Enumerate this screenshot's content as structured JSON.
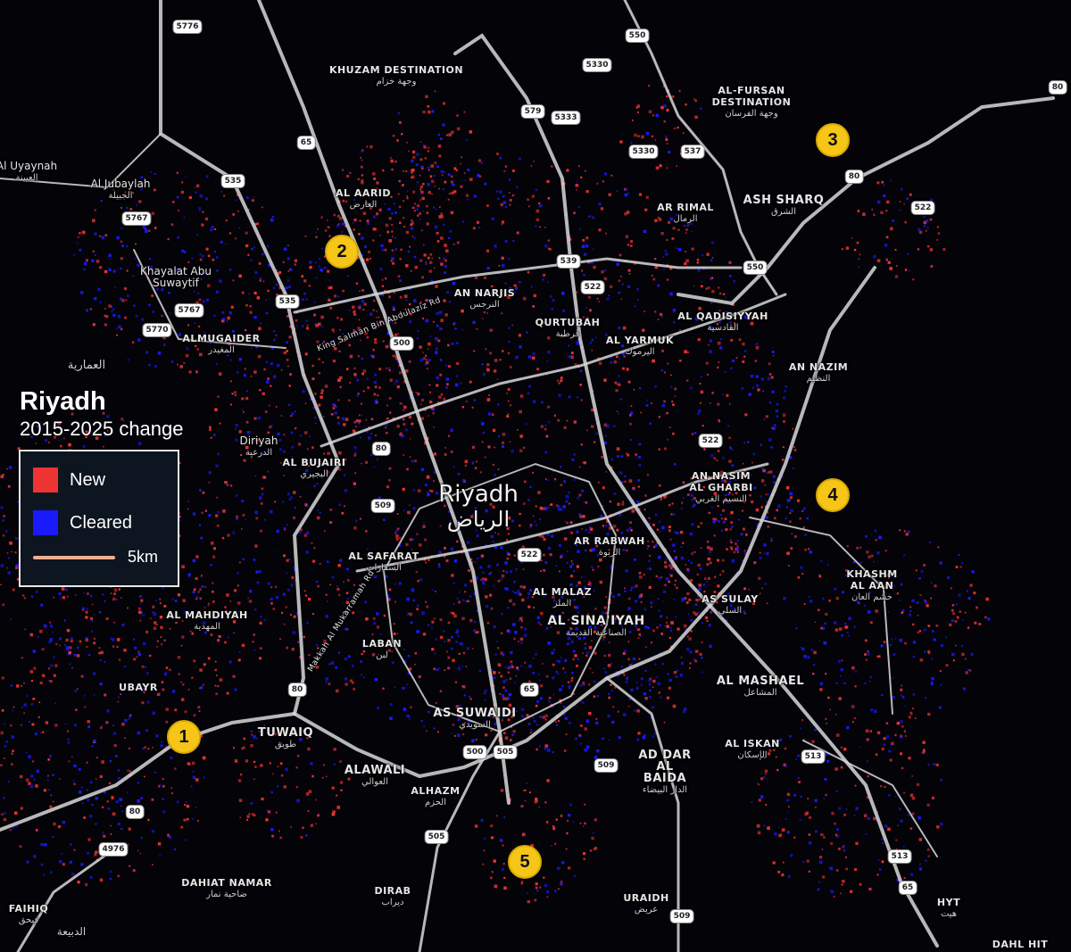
{
  "title": {
    "city": "Riyadh",
    "period": "2015-2025 change"
  },
  "legend": {
    "items": [
      {
        "label": "New",
        "color": "#ee3333"
      },
      {
        "label": "Cleared",
        "color": "#1a1aff"
      }
    ],
    "scale": {
      "label": "5km",
      "color": "#f0b090"
    }
  },
  "city_label": {
    "en": "Riyadh",
    "ar": "الرياض"
  },
  "places": [
    {
      "id": "khuzam",
      "en": "KHUZAM DESTINATION",
      "ar": "وجهة خزام"
    },
    {
      "id": "al-fursan",
      "en": "AL-FURSAN DESTINATION",
      "ar": "وجهة الفرسان"
    },
    {
      "id": "al-uyaynah",
      "en": "Al Uyaynah",
      "ar": "العيينة"
    },
    {
      "id": "al-jubaylah",
      "en": "Al Jubaylah",
      "ar": "الجبيلة"
    },
    {
      "id": "al-aarid",
      "en": "AL AARID",
      "ar": "العارض"
    },
    {
      "id": "ar-rimal",
      "en": "AR RIMAL",
      "ar": "الرمال"
    },
    {
      "id": "ash-sharq",
      "en": "ASH SHARQ",
      "ar": "الشرق"
    },
    {
      "id": "khayalat",
      "en": "Khayalat Abu Suwaytif",
      "ar": ""
    },
    {
      "id": "an-narjis",
      "en": "AN NARJIS",
      "ar": "النرجس"
    },
    {
      "id": "qurtubah",
      "en": "QURTUBAH",
      "ar": "قرطبة"
    },
    {
      "id": "al-qadisiyyah",
      "en": "AL QADISIYYAH",
      "ar": "القادسية"
    },
    {
      "id": "al-yarmuk",
      "en": "AL YARMUK",
      "ar": "اليرموك"
    },
    {
      "id": "almugaider",
      "en": "ALMUGAIDER",
      "ar": "المغيدر"
    },
    {
      "id": "al-amariyah",
      "en": "",
      "ar": "العمارية"
    },
    {
      "id": "an-nazim",
      "en": "AN NAZIM",
      "ar": "النظيم"
    },
    {
      "id": "diriyah",
      "en": "Diriyah",
      "ar": "الدرعية"
    },
    {
      "id": "al-bujairi",
      "en": "AL BUJAIRI",
      "ar": "البجيري"
    },
    {
      "id": "an-nasim-gharbi",
      "en": "AN NASIM AL GHARBI",
      "ar": "النسيم الغربي"
    },
    {
      "id": "ar-rabwah",
      "en": "AR RABWAH",
      "ar": "الربوة"
    },
    {
      "id": "al-safarat",
      "en": "AL SAFARAT",
      "ar": "السفارات"
    },
    {
      "id": "khashm-al-aan",
      "en": "KHASHM AL AAN",
      "ar": "خشم العان"
    },
    {
      "id": "al-malaz",
      "en": "AL MALAZ",
      "ar": "الملز"
    },
    {
      "id": "as-sulay",
      "en": "AS SULAY",
      "ar": "السلي"
    },
    {
      "id": "al-mahdiyah",
      "en": "AL MAHDIYAH",
      "ar": "المهدية"
    },
    {
      "id": "al-sinaiyah",
      "en": "AL SINA'IYAH",
      "ar": "الصناعية القديمة"
    },
    {
      "id": "laban",
      "en": "LABAN",
      "ar": "لبن"
    },
    {
      "id": "ubayr",
      "en": "UBAYR",
      "ar": ""
    },
    {
      "id": "al-mashael",
      "en": "AL MASHAEL",
      "ar": "المشاعل"
    },
    {
      "id": "as-suwaidi",
      "en": "AS SUWAIDI",
      "ar": "السويدي"
    },
    {
      "id": "tuwaiq",
      "en": "TUWAIQ",
      "ar": "طويق"
    },
    {
      "id": "al-iskan",
      "en": "AL ISKAN",
      "ar": "الإسكان"
    },
    {
      "id": "ad-dar-al-baida",
      "en": "AD DAR AL BAIDA",
      "ar": "الدار البيضاء"
    },
    {
      "id": "alawali",
      "en": "ALAWALI",
      "ar": "العوالي"
    },
    {
      "id": "alhazm",
      "en": "ALHAZM",
      "ar": "الحزم"
    },
    {
      "id": "dahiat-namar",
      "en": "DAHIAT NAMAR",
      "ar": "ضاحية نمار"
    },
    {
      "id": "dirab",
      "en": "DIRAB",
      "ar": "ديراب"
    },
    {
      "id": "uraidh",
      "en": "URAIDH",
      "ar": "عريض"
    },
    {
      "id": "faihiq",
      "en": "FAIHIQ",
      "ar": "فيحق"
    },
    {
      "id": "al-dabiyah",
      "en": "",
      "ar": "الدبيعة"
    },
    {
      "id": "hyt",
      "en": "HYT",
      "ar": "هيت"
    },
    {
      "id": "dahl-hit",
      "en": "DAHL HIT",
      "ar": ""
    },
    {
      "id": "ring-north",
      "en": "King Salman Bin Abdulaziz Rd",
      "ar": ""
    },
    {
      "id": "makkah-rd",
      "en": "Makkah Al Mukarramah Rd",
      "ar": ""
    }
  ],
  "road_shields": [
    "5776",
    "550",
    "5330",
    "579",
    "5333",
    "5330",
    "537",
    "65",
    "535",
    "5767",
    "535",
    "5767",
    "5770",
    "539",
    "522",
    "522",
    "80",
    "80",
    "522",
    "550",
    "500",
    "80",
    "522",
    "509",
    "65",
    "80",
    "500",
    "505",
    "513",
    "505",
    "509",
    "513",
    "65",
    "4976",
    "80",
    "509"
  ],
  "markers": [
    "1",
    "2",
    "3",
    "4",
    "5"
  ]
}
